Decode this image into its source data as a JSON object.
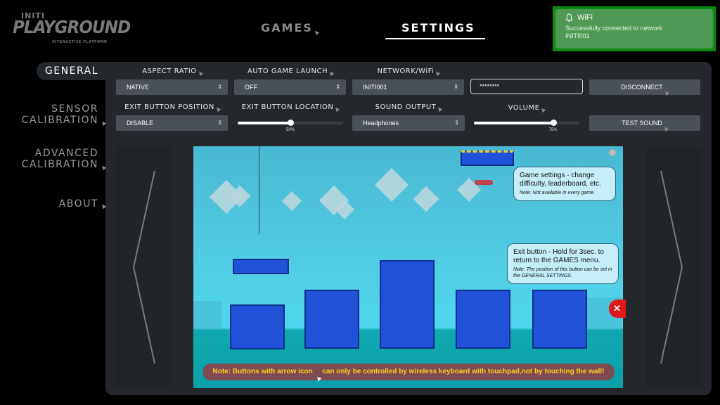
{
  "logo": {
    "brand": "INITI",
    "name": "PLAYGROUND",
    "tagline": "INTERACTIVE PLATFORM"
  },
  "topnav": {
    "games": "GAMES",
    "settings": "SETTINGS",
    "active": "settings"
  },
  "toast": {
    "title": "WiFi",
    "message": "Successfully connected to network",
    "network": "INITI001",
    "icon": "bell-icon",
    "color": "#0a8a12"
  },
  "sidebar": {
    "items": [
      {
        "label_lines": [
          "GENERAL"
        ],
        "active": true,
        "arrow_icon": false
      },
      {
        "label_lines": [
          "SENSOR",
          "CALIBRATION"
        ],
        "active": false,
        "arrow_icon": true
      },
      {
        "label_lines": [
          "ADVANCED",
          "CALIBRATION"
        ],
        "active": false,
        "arrow_icon": true
      },
      {
        "label_lines": [
          "ABOUT"
        ],
        "active": false,
        "arrow_icon": true
      }
    ]
  },
  "settings": {
    "aspect_ratio": {
      "label": "ASPECT RATIO",
      "value": "NATIVE"
    },
    "auto_game_launch": {
      "label": "AUTO GAME LAUNCH",
      "value": "OFF"
    },
    "network": {
      "label": "NETWORK/WiFi",
      "value": "INITI001",
      "password": "********"
    },
    "disconnect": {
      "label": "DISCONNECT"
    },
    "exit_button_position": {
      "label": "EXIT BUTTON POSITION",
      "value": "DISABLE"
    },
    "exit_button_location": {
      "label": "EXIT BUTTON LOCATION",
      "value": 50,
      "value_text": "50%"
    },
    "sound_output": {
      "label": "SOUND OUTPUT",
      "value": "Headphones"
    },
    "volume": {
      "label": "VOLUME",
      "value": 75,
      "value_text": "75%"
    },
    "test_sound": {
      "label": "TEST SOUND"
    }
  },
  "preview": {
    "game_settings_tip": {
      "main": "Game settings - change difficulty, leaderboard, etc.",
      "note": "Note: Not available in every game."
    },
    "exit_tip": {
      "main": "Exit button - Hold for 3sec. to return to the GAMES menu.",
      "note": "Note: The position of this button can be set in the GENERAL SETTINGS."
    },
    "exit_glyph": "✕",
    "footer_note_before": "Note: Buttons with arrow icon",
    "footer_note_after": "can only be controlled by wireless keyboard with touchpad,not by touching the wall!"
  },
  "carousel": {
    "prev": "chevron-left-icon",
    "next": "chevron-right-icon"
  }
}
